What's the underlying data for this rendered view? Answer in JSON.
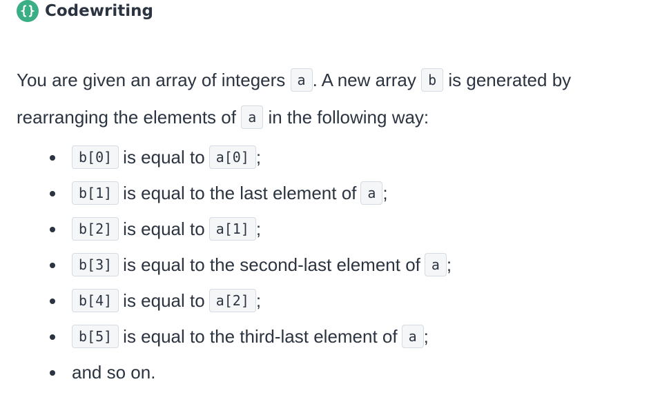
{
  "header": {
    "icon": "curly-braces-icon",
    "title": "Codewriting",
    "accent_color": "#3cae86"
  },
  "intro": {
    "t1": "You are given an array of integers ",
    "c1": "a",
    "t2": ". A new array ",
    "c2": "b",
    "t3": " is generated by rearranging the elements of ",
    "c3": "a",
    "t4": " in the following way:"
  },
  "rules": [
    {
      "lhs": "b[0]",
      "text": "is equal to",
      "rhs": "a[0]",
      "end": ";"
    },
    {
      "lhs": "b[1]",
      "text": "is equal to the last element of",
      "rhs": "a",
      "end": ";"
    },
    {
      "lhs": "b[2]",
      "text": "is equal to",
      "rhs": "a[1]",
      "end": ";"
    },
    {
      "lhs": "b[3]",
      "text": "is equal to the second-last element of",
      "rhs": "a",
      "end": ";"
    },
    {
      "lhs": "b[4]",
      "text": "is equal to",
      "rhs": "a[2]",
      "end": ";"
    },
    {
      "lhs": "b[5]",
      "text": "is equal to the third-last element of",
      "rhs": "a",
      "end": ";"
    }
  ],
  "final_item": "and so on."
}
